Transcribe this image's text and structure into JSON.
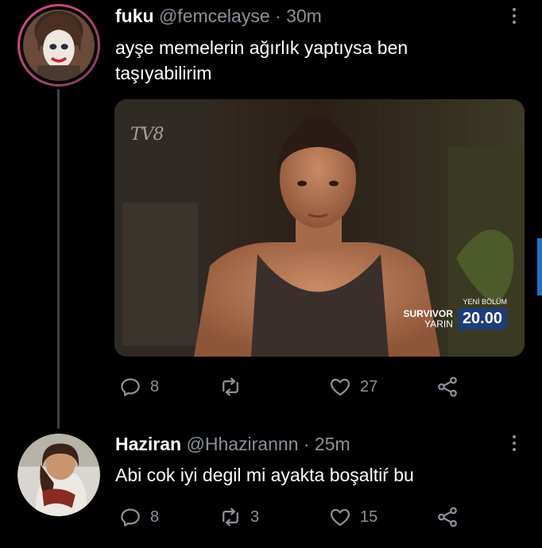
{
  "tweets": [
    {
      "name": "fuku",
      "handle": "@femcelayse",
      "separator": "·",
      "time": "30m",
      "text_line1": "ayşe memelerin ağırlık yaptıysa ben",
      "text_line2": "taşıyabilirim",
      "media": {
        "channel_logo": "TV8",
        "promo_top": "YENİ BÖLÜM",
        "promo_brand": "SURVIVOR",
        "promo_day": "YARIN",
        "promo_time": "20.00"
      },
      "replies": "8",
      "retweets": "",
      "likes": "27"
    },
    {
      "name": "Haziran",
      "handle": "@Hhazirannn",
      "separator": "·",
      "time": "25m",
      "text_line1": "Abi cok iyi degil mi ayakta boşaltiŕ bu",
      "replies": "8",
      "retweets": "3",
      "likes": "15"
    }
  ],
  "icons": {
    "reply": "reply-icon",
    "retweet": "retweet-icon",
    "like": "heart-icon",
    "share": "share-icon",
    "more": "more-vertical-icon"
  },
  "colors": {
    "background": "#000000",
    "text": "#ffffff",
    "muted": "#8b9199",
    "thread_line": "#3d4146",
    "accent": "#1d70c9"
  }
}
